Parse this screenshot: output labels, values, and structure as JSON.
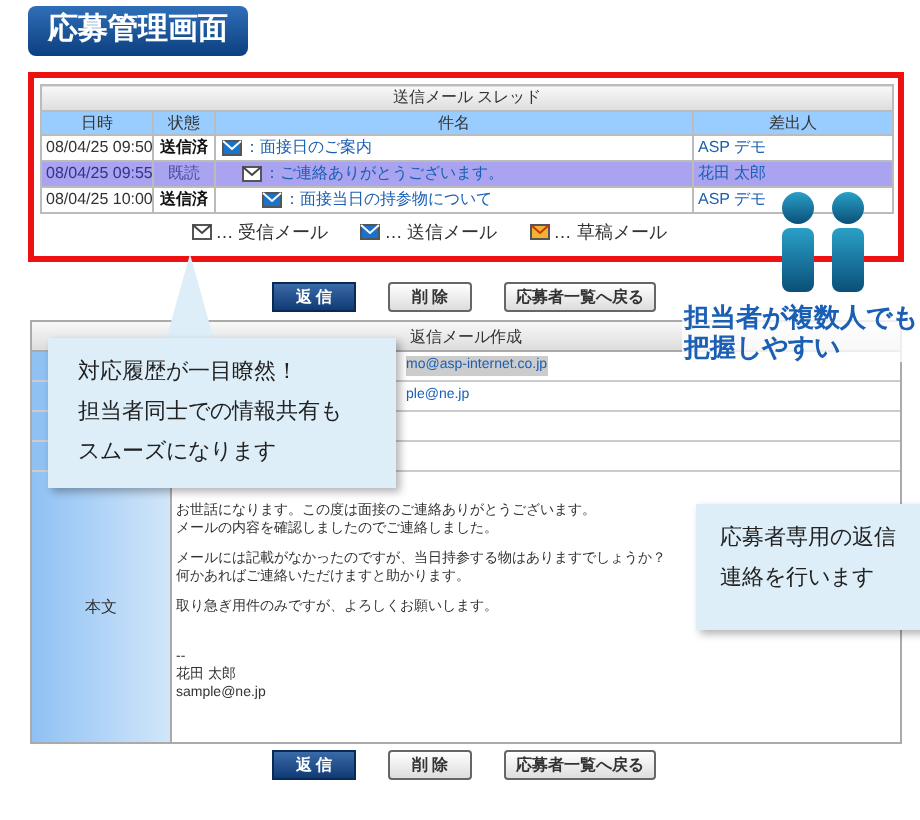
{
  "title": "応募管理画面",
  "thread": {
    "title": "送信メール スレッド",
    "columns": [
      "日時",
      "状態",
      "件名",
      "差出人"
    ],
    "rows": [
      {
        "date": "08/04/25 09:50",
        "status": "送信済",
        "kind": "sent",
        "subject": "：面接日のご案内",
        "sender": "ASP デモ",
        "selected": false,
        "children": [
          {
            "date": "08/04/25 09:55",
            "status": "既読",
            "kind": "received",
            "subject": "：ご連絡ありがとうございます。",
            "sender": "花田 太郎",
            "selected": true,
            "children": [
              {
                "date": "08/04/25 10:00",
                "status": "送信済",
                "kind": "sent",
                "subject": "：面接当日の持参物について",
                "sender": "ASP デモ",
                "selected": false
              }
            ]
          }
        ]
      }
    ]
  },
  "legend": [
    {
      "kind": "received",
      "label": "… 受信メール"
    },
    {
      "kind": "sent",
      "label": "… 送信メール"
    },
    {
      "kind": "draft",
      "label": "… 草稿メール"
    }
  ],
  "buttons_top": [
    {
      "kind": "primary",
      "label": "返 信"
    },
    {
      "kind": "secondary",
      "label": "削 除"
    },
    {
      "kind": "secondary",
      "label": "応募者一覧へ戻る"
    }
  ],
  "note": {
    "lines": [
      "担当者が複数人でも",
      "把握しやすい"
    ]
  },
  "compose": {
    "title": "返信メール作成",
    "fields": [
      {
        "value": "mo@asp-internet.co.jp",
        "selected": true
      },
      {
        "value": "ple@ne.jp",
        "selected": false
      }
    ],
    "body_label": "本文",
    "body": [
      [
        "お世話になります。この度は面接のご連絡ありがとうございます。",
        "メールの内容を確認しましたのでご連絡しました。"
      ],
      [
        "メールには記載がなかったのですが、当日持参する物はありますでしょうか？",
        "何かあればご連絡いただけますと助かります。"
      ],
      [
        "取り急ぎ用件のみですが、よろしくお願いします。"
      ],
      [
        "--",
        "花田 太郎",
        "sample@ne.jp"
      ]
    ]
  },
  "buttons_bottom": [
    {
      "kind": "primary",
      "label": "返 信"
    },
    {
      "kind": "secondary",
      "label": "削 除"
    },
    {
      "kind": "secondary",
      "label": "応募者一覧へ戻る"
    }
  ],
  "callouts": [
    {
      "lines": [
        "対応履歴が一目瞭然！",
        "担当者同士での情報共有も",
        "スムーズになります"
      ]
    },
    {
      "lines": [
        "応募者専用の返信",
        "連絡を行います"
      ]
    }
  ]
}
